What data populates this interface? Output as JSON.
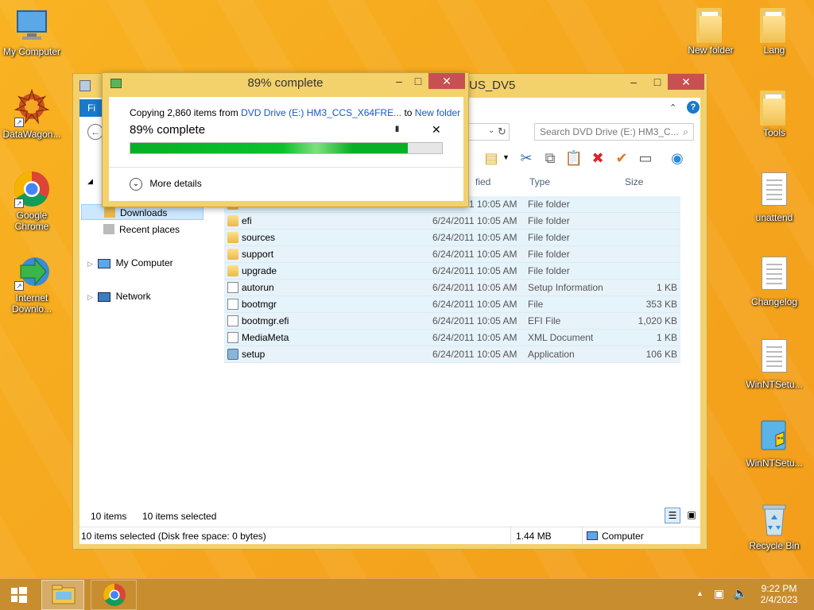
{
  "desktop": {
    "icons_left": [
      {
        "label": "My Computer"
      },
      {
        "label": "DataWagon..."
      },
      {
        "label": "Google Chrome"
      },
      {
        "label": "Internet Downlo..."
      }
    ],
    "icons_right": [
      {
        "label": "New folder"
      },
      {
        "label": "Lang"
      },
      {
        "label": "Tools"
      },
      {
        "label": "unattend"
      },
      {
        "label": "Changelog"
      },
      {
        "label": "WinNTSetu..."
      },
      {
        "label": "WinNTSetu..."
      },
      {
        "label": "Recycle Bin"
      }
    ]
  },
  "explorer": {
    "title_suffix": "US_DV5",
    "ribbon_tab": "Fi",
    "search_placeholder": "Search DVD Drive (E:) HM3_C...",
    "columns": {
      "modified": "fied",
      "type": "Type",
      "size": "Size"
    },
    "nav": {
      "downloads": "Downloads",
      "recent": "Recent places",
      "my_computer": "My Computer",
      "network": "Network"
    },
    "files": [
      {
        "name": "",
        "date": "6/24/2011 10:05 AM",
        "type": "File folder",
        "size": "",
        "icon": "folder-icon"
      },
      {
        "name": "efi",
        "date": "6/24/2011 10:05 AM",
        "type": "File folder",
        "size": "",
        "icon": "folder-icon"
      },
      {
        "name": "sources",
        "date": "6/24/2011 10:05 AM",
        "type": "File folder",
        "size": "",
        "icon": "folder-icon"
      },
      {
        "name": "support",
        "date": "6/24/2011 10:05 AM",
        "type": "File folder",
        "size": "",
        "icon": "folder-icon"
      },
      {
        "name": "upgrade",
        "date": "6/24/2011 10:05 AM",
        "type": "File folder",
        "size": "",
        "icon": "folder-icon"
      },
      {
        "name": "autorun",
        "date": "6/24/2011 10:05 AM",
        "type": "Setup Information",
        "size": "1 KB",
        "icon": "setup-info-icon"
      },
      {
        "name": "bootmgr",
        "date": "6/24/2011 10:05 AM",
        "type": "File",
        "size": "353 KB",
        "icon": "file-icon"
      },
      {
        "name": "bootmgr.efi",
        "date": "6/24/2011 10:05 AM",
        "type": "EFI File",
        "size": "1,020 KB",
        "icon": "file-icon"
      },
      {
        "name": "MediaMeta",
        "date": "6/24/2011 10:05 AM",
        "type": "XML Document",
        "size": "1 KB",
        "icon": "xml-icon"
      },
      {
        "name": "setup",
        "date": "6/24/2011 10:05 AM",
        "type": "Application",
        "size": "106 KB",
        "icon": "setup-app-icon"
      }
    ],
    "footer": {
      "item_count": "10 items",
      "selected": "10 items selected"
    },
    "status": {
      "left": "10 items selected (Disk free space: 0 bytes)",
      "size": "1.44 MB",
      "location": "Computer"
    }
  },
  "copy_dialog": {
    "title": "89% complete",
    "line_prefix": "Copying 2,860 items from ",
    "source": "DVD Drive (E:) HM3_CCS_X64FRE...",
    "to_word": " to ",
    "dest": "New folder",
    "percent_label": "89% complete",
    "progress": 0.89,
    "more_details": "More details",
    "pause_glyph": "II",
    "close_glyph": "✕"
  },
  "taskbar": {
    "time": "9:22 PM",
    "date": "2/4/2023"
  }
}
